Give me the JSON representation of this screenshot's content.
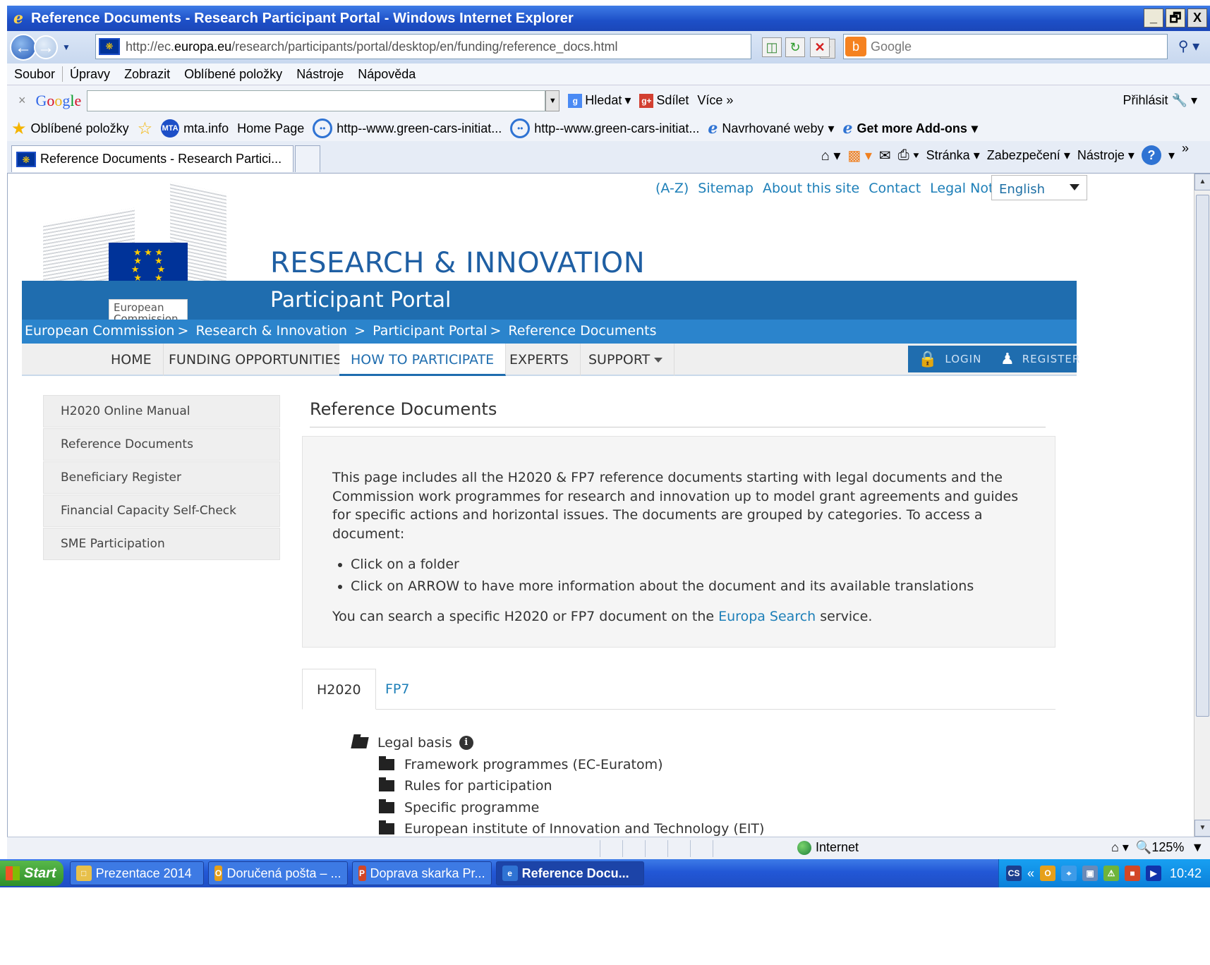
{
  "window": {
    "title": "Reference Documents - Research Participant Portal - Windows Internet Explorer",
    "buttons": [
      "_",
      "🗗",
      "X"
    ]
  },
  "address_bar": {
    "url_prefix": "http://ec.",
    "url_domain": "europa.eu",
    "url_rest": "/research/participants/portal/desktop/en/funding/reference_docs.html",
    "search_placeholder": "Google"
  },
  "menu": [
    "Soubor",
    "Úpravy",
    "Zobrazit",
    "Oblíbené položky",
    "Nástroje",
    "Nápověda"
  ],
  "google_toolbar": {
    "logo": [
      "G",
      "o",
      "o",
      "g",
      "l",
      "e"
    ],
    "search_label": "Hledat",
    "share_label": "Sdílet",
    "more_label": "Více »",
    "login_label": "Přihlásit"
  },
  "favorites_bar": {
    "favorites_label": "Oblíbené položky",
    "items": [
      "mta.info",
      "Home Page",
      "http--www.green-cars-initiat...",
      "http--www.green-cars-initiat...",
      "Navrhované weby",
      "Get more Add-ons"
    ]
  },
  "tabs": {
    "active_tab": "Reference Documents - Research Partici..."
  },
  "command_bar": {
    "page": "Stránka",
    "security": "Zabezpečení",
    "tools": "Nástroje",
    "chevron": "»"
  },
  "site": {
    "top_links": [
      "(A-Z)",
      "Sitemap",
      "About this site",
      "Contact",
      "Legal Notice"
    ],
    "language": "English",
    "ec_label_line1": "European",
    "ec_label_line2": "Commission",
    "title": "RESEARCH & INNOVATION",
    "subtitle": "Participant Portal",
    "breadcrumb": [
      "European Commission",
      "Research & Innovation",
      "Participant Portal",
      "Reference Documents"
    ],
    "nav": [
      "HOME",
      "FUNDING OPPORTUNITIES",
      "HOW TO PARTICIPATE",
      "EXPERTS",
      "SUPPORT"
    ],
    "login": "LOGIN",
    "register": "REGISTER",
    "side_menu": [
      "H2020 Online Manual",
      "Reference Documents",
      "Beneficiary Register",
      "Financial Capacity Self-Check",
      "SME Participation"
    ],
    "content_title": "Reference Documents",
    "intro": "This page includes all the H2020 & FP7 reference documents starting with legal documents and the Commission work programmes for research and innovation up to model grant agreements and guides for specific actions and horizontal issues. The documents are grouped by categories. To access a document:",
    "bullets": [
      "Click on a folder",
      "Click on ARROW to have more information about the document and its available translations"
    ],
    "search_text_before": "You can search a specific H2020 or FP7 document on the ",
    "search_link": "Europa Search",
    "search_text_after": " service.",
    "doc_tabs": [
      "H2020",
      "FP7"
    ],
    "tree_root": "Legal basis",
    "tree_children": [
      "Framework programmes (EC-Euratom)",
      "Rules for participation",
      "Specific programme",
      "European institute of Innovation and Technology (EIT)"
    ]
  },
  "status_bar": {
    "zone": "Internet",
    "zoom": "125%"
  },
  "taskbar": {
    "start": "Start",
    "tasks": [
      "Prezentace 2014",
      "Doručená pošta – ...",
      "Doprava skarka Pr...",
      "Reference Docu..."
    ],
    "tray_lang": "CS",
    "clock": "10:42"
  }
}
